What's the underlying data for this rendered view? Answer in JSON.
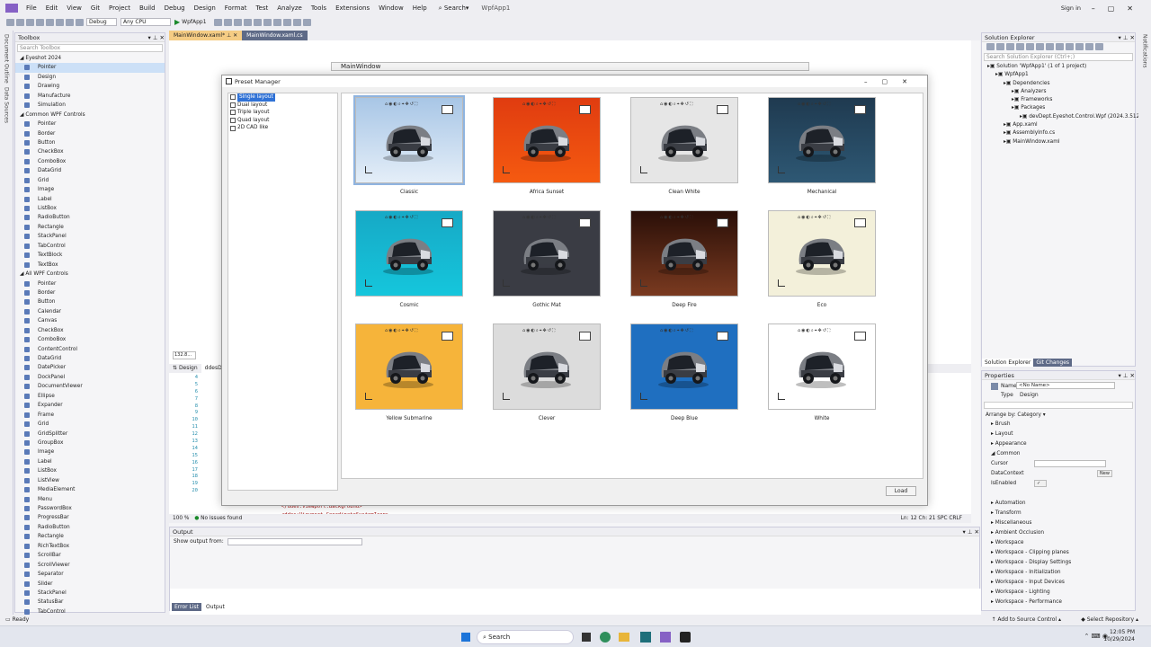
{
  "menu": [
    "File",
    "Edit",
    "View",
    "Git",
    "Project",
    "Build",
    "Debug",
    "Design",
    "Format",
    "Test",
    "Analyze",
    "Tools",
    "Extensions",
    "Window",
    "Help"
  ],
  "search_label": "Search",
  "app_name": "WpfApp1",
  "signin": "Sign in",
  "toolbar": {
    "config": "Debug",
    "platform": "Any CPU",
    "run": "WpfApp1"
  },
  "leftstrip": [
    "Document Outline",
    "Data Sources"
  ],
  "rightstrip": [
    "Notifications"
  ],
  "toolbox": {
    "title": "Toolbox",
    "search": "Search Toolbox",
    "items": [
      {
        "label": "Eyeshot 2024",
        "cat": true
      },
      {
        "label": "Pointer",
        "sel": true
      },
      {
        "label": "Design"
      },
      {
        "label": "Drawing"
      },
      {
        "label": "Manufacture"
      },
      {
        "label": "Simulation"
      },
      {
        "label": "Common WPF Controls",
        "cat": true
      },
      {
        "label": "Pointer"
      },
      {
        "label": "Border"
      },
      {
        "label": "Button"
      },
      {
        "label": "CheckBox"
      },
      {
        "label": "ComboBox"
      },
      {
        "label": "DataGrid"
      },
      {
        "label": "Grid"
      },
      {
        "label": "Image"
      },
      {
        "label": "Label"
      },
      {
        "label": "ListBox"
      },
      {
        "label": "RadioButton"
      },
      {
        "label": "Rectangle"
      },
      {
        "label": "StackPanel"
      },
      {
        "label": "TabControl"
      },
      {
        "label": "TextBlock"
      },
      {
        "label": "TextBox"
      },
      {
        "label": "All WPF Controls",
        "cat": true
      },
      {
        "label": "Pointer"
      },
      {
        "label": "Border"
      },
      {
        "label": "Button"
      },
      {
        "label": "Calendar"
      },
      {
        "label": "Canvas"
      },
      {
        "label": "CheckBox"
      },
      {
        "label": "ComboBox"
      },
      {
        "label": "ContentControl"
      },
      {
        "label": "DataGrid"
      },
      {
        "label": "DatePicker"
      },
      {
        "label": "DockPanel"
      },
      {
        "label": "DocumentViewer"
      },
      {
        "label": "Ellipse"
      },
      {
        "label": "Expander"
      },
      {
        "label": "Frame"
      },
      {
        "label": "Grid"
      },
      {
        "label": "GridSplitter"
      },
      {
        "label": "GroupBox"
      },
      {
        "label": "Image"
      },
      {
        "label": "Label"
      },
      {
        "label": "ListBox"
      },
      {
        "label": "ListView"
      },
      {
        "label": "MediaElement"
      },
      {
        "label": "Menu"
      },
      {
        "label": "PasswordBox"
      },
      {
        "label": "ProgressBar"
      },
      {
        "label": "RadioButton"
      },
      {
        "label": "Rectangle"
      },
      {
        "label": "RichTextBox"
      },
      {
        "label": "ScrollBar"
      },
      {
        "label": "ScrollViewer"
      },
      {
        "label": "Separator"
      },
      {
        "label": "Slider"
      },
      {
        "label": "StackPanel"
      },
      {
        "label": "StatusBar"
      },
      {
        "label": "TabControl"
      }
    ]
  },
  "doc_tabs": [
    "MainWindow.xaml*",
    "MainWindow.xaml.cs"
  ],
  "designer": {
    "window_title": "MainWindow",
    "zoom": "132.8...",
    "design_tab": "Design",
    "code_tab": "ddesDesign"
  },
  "code": {
    "lines": [
      "4",
      "5",
      "6",
      "7",
      "8",
      "9",
      "10",
      "11",
      "12",
      "13",
      "14",
      "15",
      "16",
      "17",
      "18",
      "19",
      "20"
    ],
    "line1": "</ddes:Viewport.Background>",
    "line2": "<ddes:Viewport.CoordinateSystemIcon>",
    "zoom": "100 %",
    "issues": "No issues found",
    "pos": "Ln: 12   Ch: 21   SPC   CRLF"
  },
  "dialog": {
    "title": "Preset Manager",
    "layouts": [
      {
        "label": "Single layout",
        "sel": true
      },
      {
        "label": "Dual layout"
      },
      {
        "label": "Triple layout"
      },
      {
        "label": "Quad layout"
      },
      {
        "label": "2D CAD like"
      }
    ],
    "presets": [
      {
        "label": "Classic",
        "bg": "linear-gradient(#a8c6e6,#e4eef8)",
        "sel": true
      },
      {
        "label": "Africa Sunset",
        "bg": "linear-gradient(#e03c10,#f55a10)"
      },
      {
        "label": "Clean White",
        "bg": "#e6e6e6"
      },
      {
        "label": "Mechanical",
        "bg": "linear-gradient(#1f3a50,#2e5874)"
      },
      {
        "label": "Cosmic",
        "bg": "linear-gradient(#16a9c6,#15c6dc)"
      },
      {
        "label": "Gothic Mat",
        "bg": "#3a3c44"
      },
      {
        "label": "Deep Fire",
        "bg": "linear-gradient(#2a0f08,#7a3a20)"
      },
      {
        "label": "Eco",
        "bg": "#f3f0da"
      },
      {
        "label": "Yellow Submarine",
        "bg": "#f6b43a"
      },
      {
        "label": "Clever",
        "bg": "#dcdcdc"
      },
      {
        "label": "Deep Blue",
        "bg": "#1f6fc0"
      },
      {
        "label": "White",
        "bg": "#ffffff"
      }
    ],
    "load": "Load"
  },
  "solution": {
    "title": "Solution Explorer",
    "search": "Search Solution Explorer (Ctrl+;)",
    "items": [
      {
        "label": "Solution 'WpfApp1' (1 of 1 project)",
        "indent": 0
      },
      {
        "label": "WpfApp1",
        "indent": 1
      },
      {
        "label": "Dependencies",
        "indent": 2
      },
      {
        "label": "Analyzers",
        "indent": 3
      },
      {
        "label": "Frameworks",
        "indent": 3
      },
      {
        "label": "Packages",
        "indent": 3
      },
      {
        "label": "devDept.Eyeshot.Control.Wpf (2024.3.512)",
        "indent": 4
      },
      {
        "label": "App.xaml",
        "indent": 2
      },
      {
        "label": "AssemblyInfo.cs",
        "indent": 2
      },
      {
        "label": "MainWindow.xaml",
        "indent": 2
      }
    ],
    "tabs": [
      "Solution Explorer",
      "Git Changes"
    ]
  },
  "properties": {
    "title": "Properties",
    "name_label": "Name",
    "name_value": "<No Name>",
    "type_label": "Type",
    "type_value": "Design",
    "arrange": "Arrange by: Category",
    "groups": [
      "Brush",
      "Layout",
      "Appearance",
      "Common"
    ],
    "common": [
      {
        "k": "Cursor",
        "v": ""
      },
      {
        "k": "DataContext",
        "v": "New"
      },
      {
        "k": "IsEnabled",
        "v": "✓"
      }
    ],
    "more": [
      "Automation",
      "Transform",
      "Miscellaneous",
      "Ambient Occlusion",
      "Workspace",
      "Workspace - Clipping planes",
      "Workspace - Display Settings",
      "Workspace - Initialization",
      "Workspace - Input Devices",
      "Workspace - Lighting",
      "Workspace - Performance"
    ]
  },
  "output": {
    "title": "Output",
    "show_from": "Show output from:",
    "tabs": [
      "Error List",
      "Output"
    ]
  },
  "status": {
    "ready": "Ready",
    "source": "Add to Source Control",
    "repo": "Select Repository"
  },
  "taskbar": {
    "search": "Search",
    "time": "12:05 PM",
    "date": "10/29/2024"
  }
}
